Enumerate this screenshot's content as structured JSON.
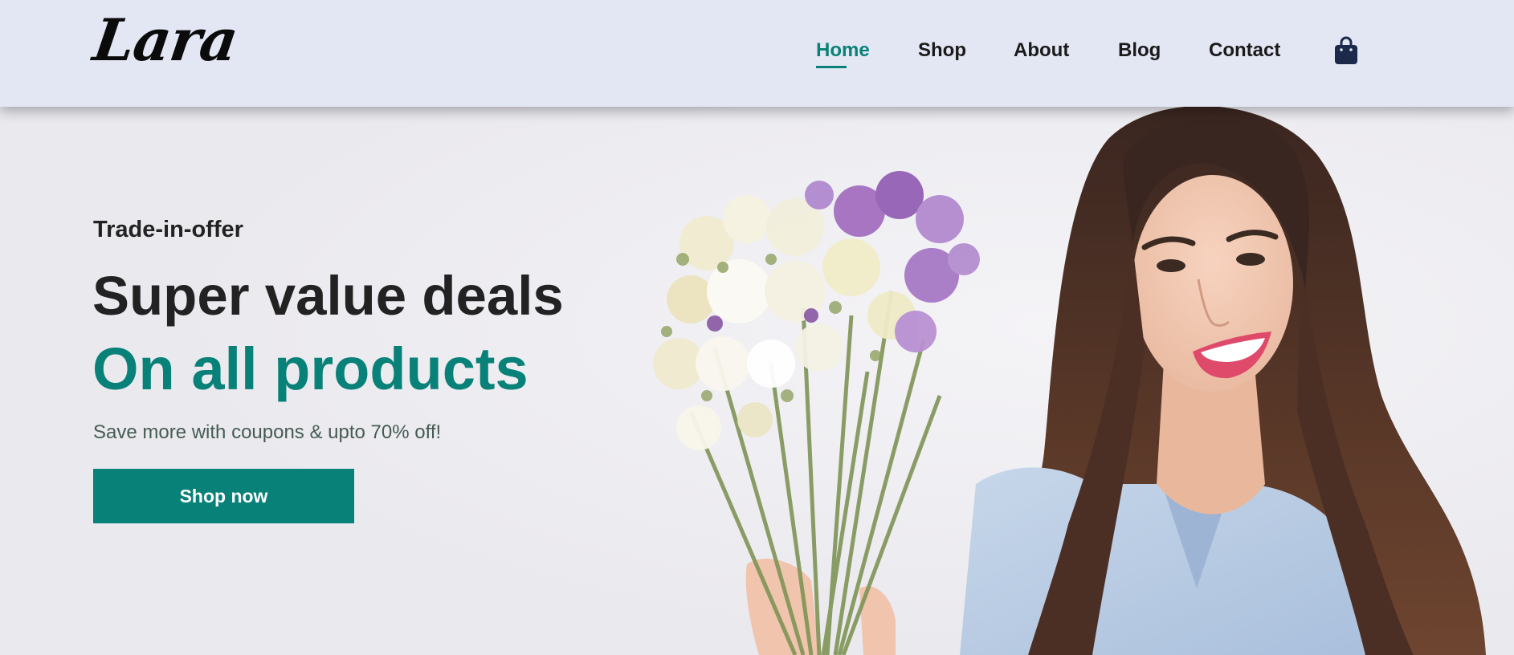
{
  "header": {
    "logo": "Lara",
    "nav": [
      {
        "label": "Home",
        "active": true
      },
      {
        "label": "Shop",
        "active": false
      },
      {
        "label": "About",
        "active": false
      },
      {
        "label": "Blog",
        "active": false
      },
      {
        "label": "Contact",
        "active": false
      }
    ],
    "cart_icon": "shopping-bag-icon"
  },
  "hero": {
    "eyebrow": "Trade-in-offer",
    "headline": "Super value deals",
    "headline_accent": "On all products",
    "subtext": "Save more with coupons & upto 70% off!",
    "cta_label": "Shop now",
    "image": "woman-holding-dried-flower-bouquet"
  },
  "colors": {
    "accent": "#088178",
    "header_bg": "#e3e6f3",
    "text_dark": "#222222",
    "bag_icon": "#1b2a4a"
  }
}
